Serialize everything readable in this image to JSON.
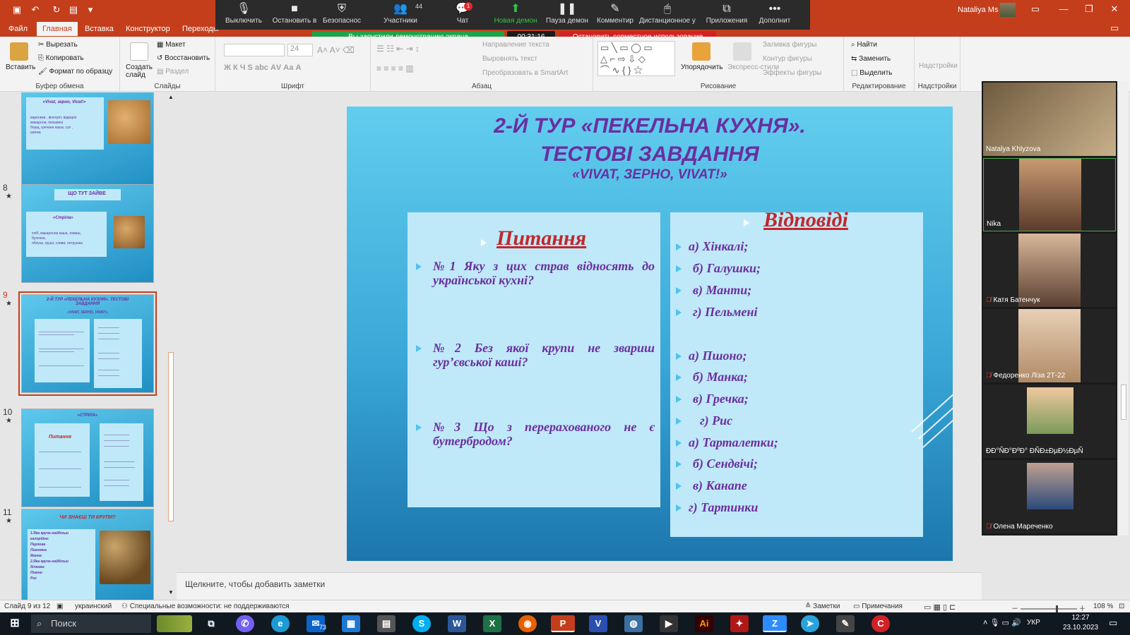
{
  "titlebar": {
    "user": "Nataliya Ms",
    "colors": {
      "accent": "#c43e1c"
    }
  },
  "tabs": [
    "Файл",
    "Главная",
    "Вставка",
    "Конструктор",
    "Переходы"
  ],
  "zoom": {
    "buttons": [
      {
        "label": "Выключить",
        "icon": "mic-icon"
      },
      {
        "label": "Остановить в",
        "icon": "camera-icon"
      },
      {
        "label": "Безопаснос",
        "icon": "shield-icon"
      },
      {
        "label": "Участники",
        "icon": "participants-icon",
        "badge": "44"
      },
      {
        "label": "Чат",
        "icon": "chat-icon",
        "badge": "1"
      },
      {
        "label": "Новая демон",
        "icon": "share-screen-icon"
      },
      {
        "label": "Пауза демон",
        "icon": "pause-icon"
      },
      {
        "label": "Комментир",
        "icon": "annotate-icon"
      },
      {
        "label": "Дистанционное у",
        "icon": "remote-control-icon"
      },
      {
        "label": "Приложения",
        "icon": "apps-icon"
      },
      {
        "label": "Дополнит",
        "icon": "more-icon"
      }
    ],
    "share_banner": "Вы запустили демонстрацию экрана",
    "timer": "00:31:16",
    "stop_share": "Остановить совместное использование"
  },
  "ribbon": {
    "clipboard": {
      "paste": "Вставить",
      "cut": "Вырезать",
      "copy": "Копировать",
      "format": "Формат по образцу",
      "label": "Буфер обмена"
    },
    "slides": {
      "new": "Создать слайд",
      "layout": "Макет",
      "reset": "Восстановить",
      "section": "Раздел",
      "label": "Слайды"
    },
    "font": {
      "size": "24",
      "label": "Шрифт"
    },
    "paragraph": {
      "dir": "Направление текста",
      "align": "Выровнять текст",
      "smartart": "Преобразовать в SmartArt",
      "label": "Абзац"
    },
    "drawing": {
      "arrange": "Упорядочить",
      "styles": "Экспресс-стили",
      "fill": "Заливка фигуры",
      "outline": "Контур фигуры",
      "effects": "Эффекты фигуры",
      "label": "Рисование"
    },
    "editing": {
      "find": "Найти",
      "replace": "Заменить",
      "select": "Выделить",
      "label": "Редактирование"
    },
    "addins": {
      "btn": "Надстройки",
      "label": "Надстройки"
    }
  },
  "thumbnails": [
    {
      "num": "",
      "title": "«Vivat, зерно, Vivat!»",
      "lines": [
        "вареники , вінегрет, відварні",
        "макарони, пельмені",
        "борщ, гречана каша, суп ,",
        "шинка"
      ]
    },
    {
      "num": "8",
      "title": "ЩО  ТУТ ЗАЙВЕ",
      "sub": "«Стріла»",
      "lines": [
        "хліб, макаронна каша, лаваш,",
        "булочка,",
        "яблука, груші, сливи, петрушка"
      ]
    },
    {
      "num": "9",
      "title": "2-Й ТУР «ПЕКЕЛЬНА КУХНЯ». ТЕСТОВІ ЗАВДАННЯ",
      "sub": "«VIVAT, ЗЕРНО, VIVAT!»"
    },
    {
      "num": "10",
      "title": "«СТРІЛА»",
      "sub": "Питання"
    },
    {
      "num": "11",
      "title": "ЧИ ЗНАЄШ ТИ КРУПИ?",
      "lines": [
        "1.Яка крупа найбільш",
        "калорійна:",
        "Перлова",
        "Пшоняна",
        "Манна",
        "2.Яка крупа найбільш",
        "білкова:",
        "Пшено",
        "Рис"
      ]
    }
  ],
  "slide": {
    "title_1": "2-Й ТУР «ПЕКЕЛЬНА КУХНЯ».",
    "title_2": "ТЕСТОВІ ЗАВДАННЯ",
    "subtitle": "«VIVAT, ЗЕРНО, VIVAT!»",
    "questions_head": "Питання",
    "answers_head": "Відповіді",
    "questions": [
      "№1 Яку з цих страв відносять до української кухні?",
      "№2 Без якої крупи не звариш гур’євської каші?",
      "№3 Що з перерахованого не є бутербродом?"
    ],
    "answers": [
      "а) Хінкалі;",
      "б) Галушки;",
      "в) Манти;",
      "г) Пельмені",
      "а) Пшоно;",
      "б) Манка;",
      "в) Гречка;",
      "г) Рис",
      "а) Тарталетки;",
      "б) Сендвічі;",
      "в) Канапе",
      "г) Тартинки"
    ]
  },
  "notes_placeholder": "Щелкните, чтобы добавить заметки",
  "participants": [
    {
      "name": "Natalya Khlyzova",
      "muted": false
    },
    {
      "name": "Nika",
      "muted": false
    },
    {
      "name": "Катя Батенчук",
      "muted": true
    },
    {
      "name": "Федоренко Ліза 2Т-22",
      "muted": true
    },
    {
      "name": "ÐÐ°ÑÐ°ÐºÐ° ÐÑÐ±ÐµÐ½ÐµÑ",
      "muted": false
    },
    {
      "name": "Олена Мареченко",
      "muted": true
    }
  ],
  "status": {
    "slide_info": "Слайд 9 из 12",
    "language": "украинский",
    "accessibility": "Специальные возможности: не поддерживаются",
    "notes": "Заметки",
    "comments": "Примечания",
    "zoom": "108 %"
  },
  "taskbar": {
    "search": "Поиск",
    "lang": "УКР",
    "time": "12:27",
    "date": "23.10.2023",
    "mail_badge": "73"
  }
}
